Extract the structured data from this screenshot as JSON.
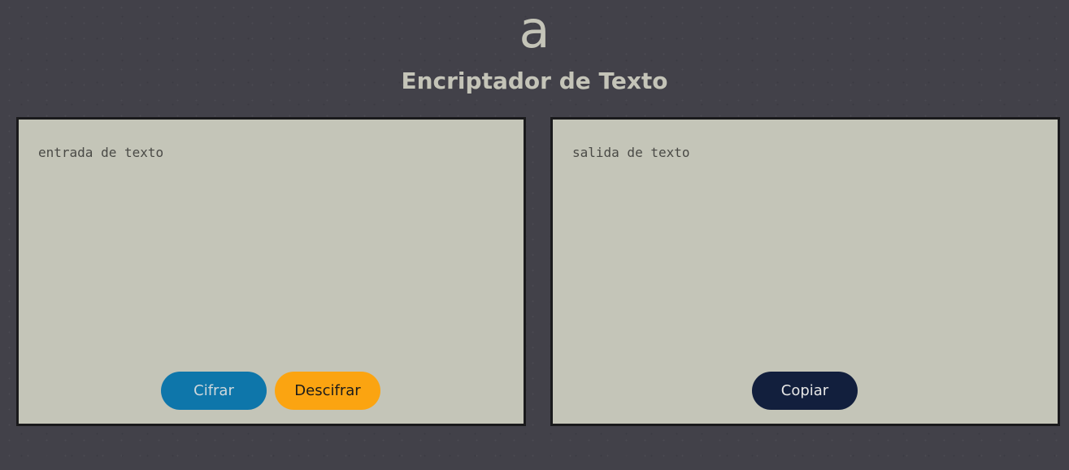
{
  "header": {
    "logo_text": "a",
    "title": "Encriptador de Texto"
  },
  "input_panel": {
    "placeholder": "entrada de texto",
    "value": "",
    "encrypt_label": "Cifrar",
    "decrypt_label": "Descifrar"
  },
  "output_panel": {
    "placeholder": "salida de texto",
    "value": "",
    "copy_label": "Copiar"
  },
  "colors": {
    "background": "#424149",
    "panel": "#c4c5b8",
    "title_text": "#c4c4b8",
    "encrypt_button": "#0e76aa",
    "decrypt_button": "#fba411",
    "copy_button": "#121f3d"
  }
}
